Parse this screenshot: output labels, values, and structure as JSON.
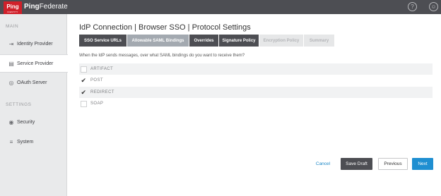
{
  "app": {
    "logo_text": "Ping",
    "logo_subtext": "IDENTITY",
    "brand_bold": "Ping",
    "brand_light": "Federate",
    "help_icon": "?",
    "user_icon": "☺"
  },
  "sidebar": {
    "main_heading": "MAIN",
    "settings_heading": "SETTINGS",
    "items": [
      {
        "label": "Identity Provider",
        "icon": "⇥"
      },
      {
        "label": "Service Provider",
        "icon": "▤"
      },
      {
        "label": "OAuth Server",
        "icon": "◎"
      },
      {
        "label": "Security",
        "icon": "◉"
      },
      {
        "label": "System",
        "icon": "≡"
      }
    ]
  },
  "main": {
    "title": "IdP Connection | Browser SSO | Protocol Settings",
    "tabs": [
      {
        "label": "SSO Service URLs",
        "state": "done"
      },
      {
        "label": "Allowable SAML Bindings",
        "state": "current"
      },
      {
        "label": "Overrides",
        "state": "done"
      },
      {
        "label": "Signature Policy",
        "state": "done"
      },
      {
        "label": "Encryption Policy",
        "state": "future"
      },
      {
        "label": "Summary",
        "state": "future"
      }
    ],
    "question": "When the IdP sends messages, over what SAML bindings do you want to receive them?",
    "options": [
      {
        "label": "ARTIFACT",
        "checked": false,
        "mark": ""
      },
      {
        "label": "POST",
        "checked": true,
        "mark": "✔"
      },
      {
        "label": "REDIRECT",
        "checked": true,
        "mark": "✔"
      },
      {
        "label": "SOAP",
        "checked": false,
        "mark": ""
      }
    ]
  },
  "footer": {
    "cancel": "Cancel",
    "save_draft": "Save Draft",
    "previous": "Previous",
    "next": "Next"
  },
  "colors": {
    "topbar": "#4d4e53",
    "logo_red": "#d0202a",
    "accent_blue": "#1f8fd1",
    "link_blue": "#1e88c7"
  }
}
